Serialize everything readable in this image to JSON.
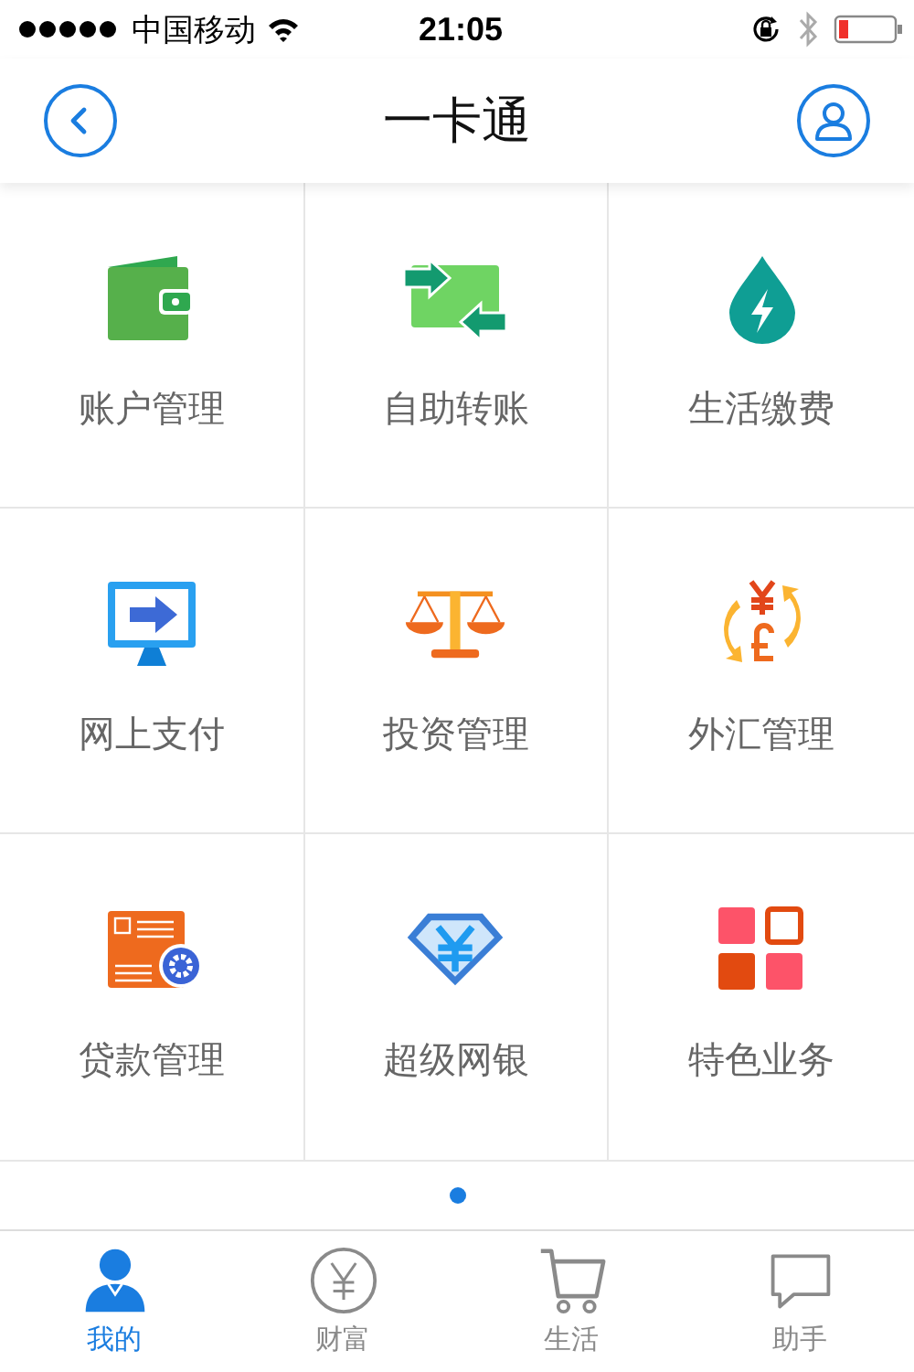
{
  "status_bar": {
    "carrier": "中国移动",
    "time": "21:05"
  },
  "nav": {
    "title": "一卡通"
  },
  "grid": [
    {
      "label": "账户管理",
      "kind": "wallet"
    },
    {
      "label": "自助转账",
      "kind": "transfer"
    },
    {
      "label": "生活缴费",
      "kind": "utility"
    },
    {
      "label": "网上支付",
      "kind": "monitor"
    },
    {
      "label": "投资管理",
      "kind": "scale"
    },
    {
      "label": "外汇管理",
      "kind": "exchange"
    },
    {
      "label": "贷款管理",
      "kind": "loan"
    },
    {
      "label": "超级网银",
      "kind": "diamond"
    },
    {
      "label": "特色业务",
      "kind": "tiles"
    }
  ],
  "pager": [
    {
      "selected": true
    }
  ],
  "tabs": [
    {
      "label": "我的",
      "kind": "person",
      "selected": true
    },
    {
      "label": "财富",
      "kind": "coin",
      "selected": false
    },
    {
      "label": "生活",
      "kind": "cart",
      "selected": false
    },
    {
      "label": "助手",
      "kind": "chat",
      "selected": false
    }
  ]
}
